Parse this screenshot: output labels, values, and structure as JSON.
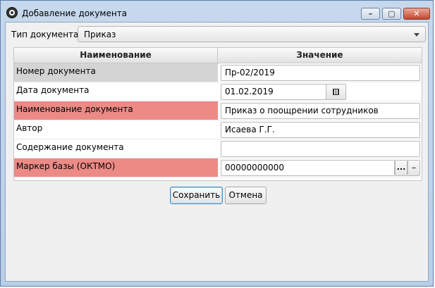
{
  "window": {
    "title": "Добавление документа",
    "controls": {
      "minimize": "–",
      "maximize": "▢",
      "close": "✕"
    }
  },
  "doc_type": {
    "label": "Тип документа:",
    "value": "Приказ"
  },
  "grid": {
    "headers": [
      "Наименование",
      "Значение"
    ],
    "rows": [
      {
        "name": "Номер документа",
        "value": "Пр-02/2019",
        "highlight": "gray"
      },
      {
        "name": "Дата документа",
        "value": "01.02.2019",
        "highlight": "none"
      },
      {
        "name": "Наименование документа",
        "value": "Приказ о поощрении сотрудников",
        "highlight": "red"
      },
      {
        "name": "Автор",
        "value": "Исаева Г.Г.",
        "highlight": "none"
      },
      {
        "name": "Содержание документа",
        "value": "",
        "highlight": "none"
      },
      {
        "name": "Маркер базы (ОКТМО)",
        "value": "00000000000",
        "highlight": "red"
      }
    ]
  },
  "buttons": {
    "save": "Сохранить",
    "cancel": "Отмена",
    "browse": "...",
    "remove": "–"
  },
  "colors": {
    "required_highlight": "#ec8a86",
    "selected_highlight": "#d4d4d4",
    "window_frame": "#b9cfe7"
  }
}
